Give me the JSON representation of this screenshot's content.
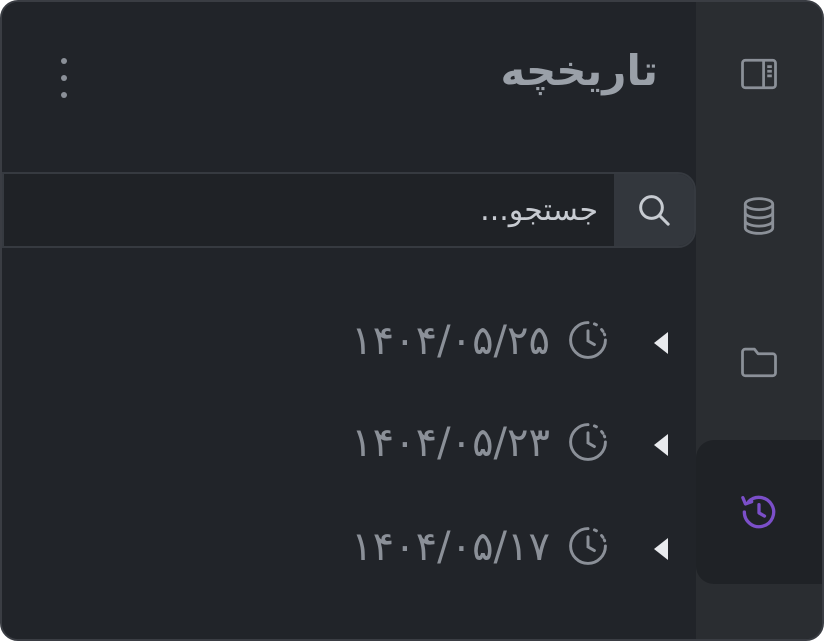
{
  "panel": {
    "title": "تاریخچه"
  },
  "search": {
    "placeholder": "جستجو..."
  },
  "history": [
    {
      "label": "۱۴۰۴/۰۵/۲۵"
    },
    {
      "label": "۱۴۰۴/۰۵/۲۳"
    },
    {
      "label": "۱۴۰۴/۰۵/۱۷"
    }
  ],
  "rail": {
    "items": [
      {
        "icon": "panel-icon"
      },
      {
        "icon": "database-icon"
      },
      {
        "icon": "folder-icon"
      },
      {
        "icon": "history-icon",
        "active": true
      }
    ]
  },
  "colors": {
    "background": "#212429",
    "rail": "#2a2d31",
    "accent": "#7b4fc9",
    "text_muted": "#8b9098"
  }
}
